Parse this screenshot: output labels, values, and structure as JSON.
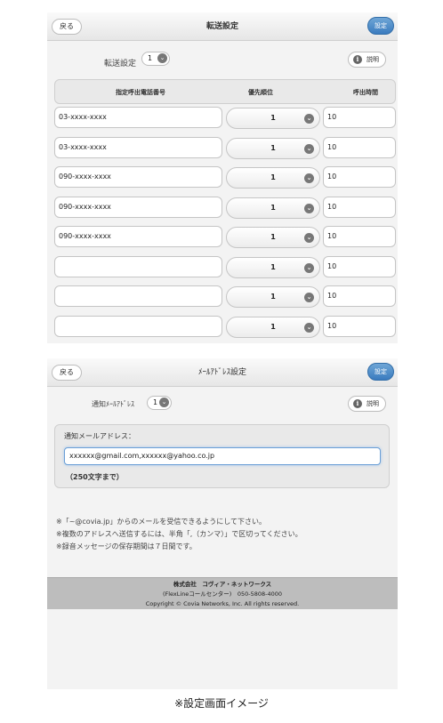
{
  "forwarding": {
    "back_label": "戻る",
    "title": "転送設定",
    "save_label": "設定",
    "setting_label": "転送設定",
    "setting_value": "1",
    "help_label": "説明",
    "columns": [
      "指定呼出電話番号",
      "優先順位",
      "呼出時間"
    ],
    "rows": [
      {
        "phone": "03-xxxx-xxxx",
        "priority": "1",
        "time": "10"
      },
      {
        "phone": "03-xxxx-xxxx",
        "priority": "1",
        "time": "10"
      },
      {
        "phone": "090-xxxx-xxxx",
        "priority": "1",
        "time": "10"
      },
      {
        "phone": "090-xxxx-xxxx",
        "priority": "1",
        "time": "10"
      },
      {
        "phone": "090-xxxx-xxxx",
        "priority": "1",
        "time": "10"
      },
      {
        "phone": "",
        "priority": "1",
        "time": "10"
      },
      {
        "phone": "",
        "priority": "1",
        "time": "10"
      },
      {
        "phone": "",
        "priority": "1",
        "time": "10"
      }
    ]
  },
  "mail": {
    "back_label": "戻る",
    "title": "ﾒｰﾙｱﾄﾞﾚｽ設定",
    "save_label": "設定",
    "setting_label": "通知ﾒｰﾙｱﾄﾞﾚｽ",
    "setting_value": "1",
    "help_label": "説明",
    "field_label": "通知メールアドレス：",
    "field_value": "xxxxxx@gmail.com,xxxxxx@yahoo.co.jp",
    "field_hint": "（250文字まで）",
    "notes": [
      "※「~@covia.jp」からのメールを受信できるようにして下さい。",
      "※複数のアドレスへ送信するには、半角「,（カンマ）」で区切ってください。",
      "※録音メッセージの保存期間は７日間です。"
    ],
    "footer": {
      "company": "株式会社　コヴィア・ネットワークス",
      "center": "(FlexLineコールセンター)　050-5808-4000",
      "copyright": "Copyright © Covia Networks, Inc. All rights reserved."
    }
  },
  "caption": "※設定画面イメージ",
  "colors": {
    "accent": "#3a7bbf",
    "background": "#f3f3f3",
    "footer": "#bdbdbd"
  },
  "icons": [
    "chevron-down-icon",
    "info-icon"
  ]
}
